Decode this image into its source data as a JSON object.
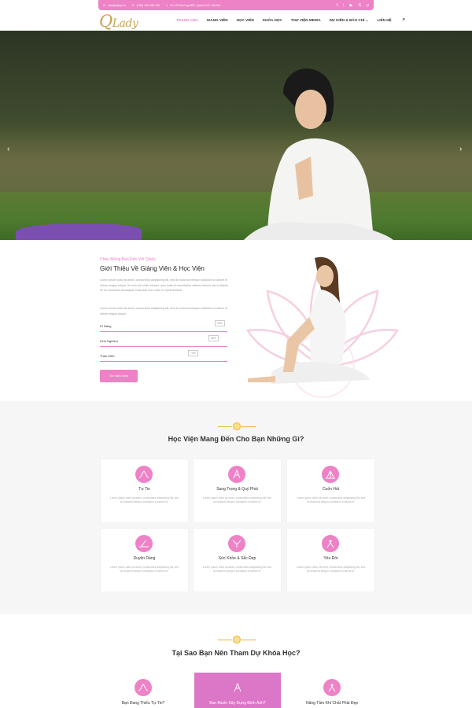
{
  "topbar": {
    "email": "info@qlady.vn",
    "phone": "(+84) 123 456 789",
    "address": "Số 123 Đường ABC, Quận XYZ, Hà Nội",
    "social_icons": [
      "facebook-icon",
      "twitter-icon",
      "youtube-icon",
      "google-plus-icon",
      "pinterest-icon"
    ]
  },
  "logo": {
    "initial": "Q",
    "rest": "Lady"
  },
  "nav": {
    "items": [
      "TRANG CHỦ",
      "GIẢNG VIÊN",
      "HỌC VIÊN",
      "KHÓA HỌC",
      "THƯ VIỆN MEDIA",
      "DỰ KIẾN & BÁO CHÍ",
      "LIÊN HỆ"
    ]
  },
  "hero": {
    "prev": "‹",
    "next": "›"
  },
  "about": {
    "eyebrow": "Chào Mừng Bạn Đến Với Qlady",
    "title": "Giới Thiệu Về Giảng Viên & Học Viện",
    "para1": "Lorem ipsum dolor sit amet, consectetur adipisicing elit, sed do eiusmod tempor incididunt ut labore et dolore magna aliqua. Ut enim ad minim veniam, quis nostrud exercitation ullamco laboris nisi ut aliquip ex ea commodo consequat. Duis aute irure dolor in reprehenderit.",
    "para2": "Lorem ipsum dolor sit amet, consectetur adipisicing elit, sed do eiusmod tempor incididunt ut labore et dolore magna aliqua.",
    "skills": [
      {
        "label": "Kĩ Năng",
        "percent": "90%"
      },
      {
        "label": "Kinh Nghiệm",
        "percent": "85%"
      },
      {
        "label": "Thấu Hiểu",
        "percent": "70%"
      }
    ],
    "button": "Tìm hiểu thêm"
  },
  "benefits": {
    "title": "Học Viện Mang Đến Cho Bạn Những Gì?",
    "cards": [
      {
        "title": "Tự Tin",
        "text": "Lorem ipsum dolor sit amet, consectetur adipisicing elit, sed do eiusmod tempor incididunt ut labore et."
      },
      {
        "title": "Sang Trọng & Quý Phái",
        "text": "Lorem ipsum dolor sit amet, consectetur adipisicing elit, sed do eiusmod tempor incididunt ut labore et."
      },
      {
        "title": "Cuốn Hút",
        "text": "Lorem ipsum dolor sit amet, consectetur adipisicing elit, sed do eiusmod tempor incididunt ut labore et."
      },
      {
        "title": "Duyên Dáng",
        "text": "Lorem ipsum dolor sit amet, consectetur adipisicing elit, sed do eiusmod tempor incididunt ut labore et."
      },
      {
        "title": "Sức Khỏe & Sắc Đẹp",
        "text": "Lorem ipsum dolor sit amet, consectetur adipisicing elit, sed do eiusmod tempor incididunt ut labore et."
      },
      {
        "title": "Yêu Đời",
        "text": "Lorem ipsum dolor sit amet, consectetur adipisicing elit, sed do eiusmod tempor incididunt ut labore et."
      }
    ]
  },
  "reasons": {
    "title": "Tại Sao Bạn Nên Tham Dự Khóa Học?",
    "items": [
      "Bạn Đang Thiếu Tự Tin?",
      "Bạn Muốn Xây Dựng Định Ảnh?",
      "Nâng Tầm Khí Chất Phái Đẹp"
    ]
  },
  "colors": {
    "accent": "#ee82c6",
    "gold": "#e8b536",
    "logo": "#c9a24e"
  }
}
